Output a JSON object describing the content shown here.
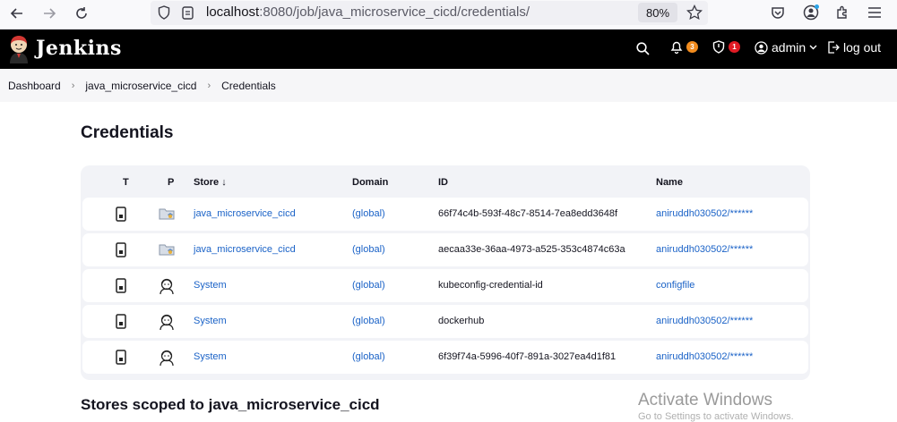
{
  "browser": {
    "url_host": "localhost",
    "url_rest": ":8080/job/java_microservice_cicd/credentials/",
    "zoom": "80%"
  },
  "header": {
    "logo": "Jenkins",
    "notifications_count": "3",
    "security_count": "1",
    "user": "admin",
    "logout": "log out",
    "notif_color": "#f28c1e",
    "security_color": "#e01b24"
  },
  "breadcrumb": [
    "Dashboard",
    "java_microservice_cicd",
    "Credentials"
  ],
  "page_title": "Credentials",
  "table": {
    "headers": {
      "t": "T",
      "p": "P",
      "store": "Store",
      "store_sort": "↓",
      "domain": "Domain",
      "id": "ID",
      "name": "Name"
    },
    "rows": [
      {
        "store": "java_microservice_cicd",
        "store_icon": "folder-icon",
        "domain": "(global)",
        "id": "66f74c4b-593f-48c7-8514-7ea8edd3648f",
        "name": "aniruddh030502/******"
      },
      {
        "store": "java_microservice_cicd",
        "store_icon": "folder-icon",
        "domain": "(global)",
        "id": "aecaa33e-36aa-4973-a525-353c4874c63a",
        "name": "aniruddh030502/******"
      },
      {
        "store": "System",
        "store_icon": "jenkins-system-icon",
        "domain": "(global)",
        "id": "kubeconfig-credential-id",
        "name": "configfile"
      },
      {
        "store": "System",
        "store_icon": "jenkins-system-icon",
        "domain": "(global)",
        "id": "dockerhub",
        "name": "aniruddh030502/******"
      },
      {
        "store": "System",
        "store_icon": "jenkins-system-icon",
        "domain": "(global)",
        "id": "6f39f74a-5996-40f7-891a-3027ea4d1f81",
        "name": "aniruddh030502/******"
      }
    ]
  },
  "section_title": "Stores scoped to java_microservice_cicd",
  "watermark": {
    "line1": "Activate Windows",
    "line2": "Go to Settings to activate Windows."
  }
}
